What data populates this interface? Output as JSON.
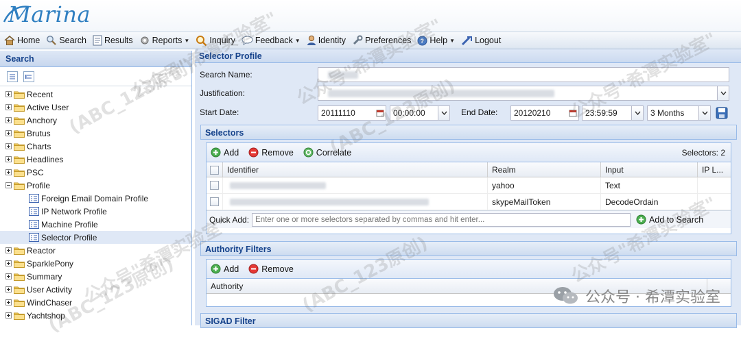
{
  "app": {
    "logo_text": "Marina"
  },
  "toolbar": {
    "home": "Home",
    "search": "Search",
    "results": "Results",
    "reports": "Reports",
    "inquiry": "Inquiry",
    "feedback": "Feedback",
    "identity": "Identity",
    "preferences": "Preferences",
    "help": "Help",
    "logout": "Logout"
  },
  "left_panel": {
    "title": "Search",
    "tree": [
      {
        "label": "Recent",
        "type": "folder",
        "expanded": false
      },
      {
        "label": "Active User",
        "type": "folder",
        "expanded": false
      },
      {
        "label": "Anchory",
        "type": "folder",
        "expanded": false
      },
      {
        "label": "Brutus",
        "type": "folder",
        "expanded": false
      },
      {
        "label": "Charts",
        "type": "folder",
        "expanded": false
      },
      {
        "label": "Headlines",
        "type": "folder",
        "expanded": false
      },
      {
        "label": "PSC",
        "type": "folder",
        "expanded": false
      },
      {
        "label": "Profile",
        "type": "folder",
        "expanded": true
      },
      {
        "label": "Foreign Email Domain Profile",
        "type": "leaf"
      },
      {
        "label": "IP Network Profile",
        "type": "leaf"
      },
      {
        "label": "Machine Profile",
        "type": "leaf"
      },
      {
        "label": "Selector Profile",
        "type": "leaf",
        "selected": true
      },
      {
        "label": "Reactor",
        "type": "folder",
        "expanded": false
      },
      {
        "label": "SparklePony",
        "type": "folder",
        "expanded": false
      },
      {
        "label": "Summary",
        "type": "folder",
        "expanded": false
      },
      {
        "label": "User Activity",
        "type": "folder",
        "expanded": false
      },
      {
        "label": "WindChaser",
        "type": "folder",
        "expanded": false
      },
      {
        "label": "Yachtshop",
        "type": "folder",
        "expanded": false
      }
    ]
  },
  "main": {
    "title": "Selector Profile",
    "search_name_label": "Search Name:",
    "justification_label": "Justification:",
    "start_date_label": "Start Date:",
    "start_date": "20111110",
    "start_time": "00:00:00",
    "end_date_label": "End Date:",
    "end_date": "20120210",
    "end_time": "23:59:59",
    "range": "3 Months",
    "selectors": {
      "title": "Selectors",
      "add": "Add",
      "remove": "Remove",
      "correlate": "Correlate",
      "count": "Selectors: 2",
      "columns": [
        "Identifier",
        "Realm",
        "Input",
        "IP L..."
      ],
      "rows": [
        {
          "realm": "yahoo",
          "input": "Text"
        },
        {
          "realm": "skypeMailToken",
          "input": "DecodeOrdain"
        }
      ],
      "quick_add_label": "Quick Add:",
      "quick_add_placeholder": "Enter one or more selectors separated by commas and hit enter...",
      "add_to_search": "Add to Search"
    },
    "authority_filters": {
      "title": "Authority Filters",
      "add": "Add",
      "remove": "Remove",
      "column": "Authority"
    },
    "sigad_filter": {
      "title": "SIGAD Filter"
    }
  },
  "watermark": {
    "text1": "公众号\"希潭实验室\"",
    "text2": "(ABC_123原创)",
    "footer": "公众号 · 希潭实验室"
  },
  "colors": {
    "panel_header_text": "#15428b",
    "panel_bg": "#dfe8f6",
    "border": "#99bbe8",
    "logo": "#2f7fc1"
  }
}
